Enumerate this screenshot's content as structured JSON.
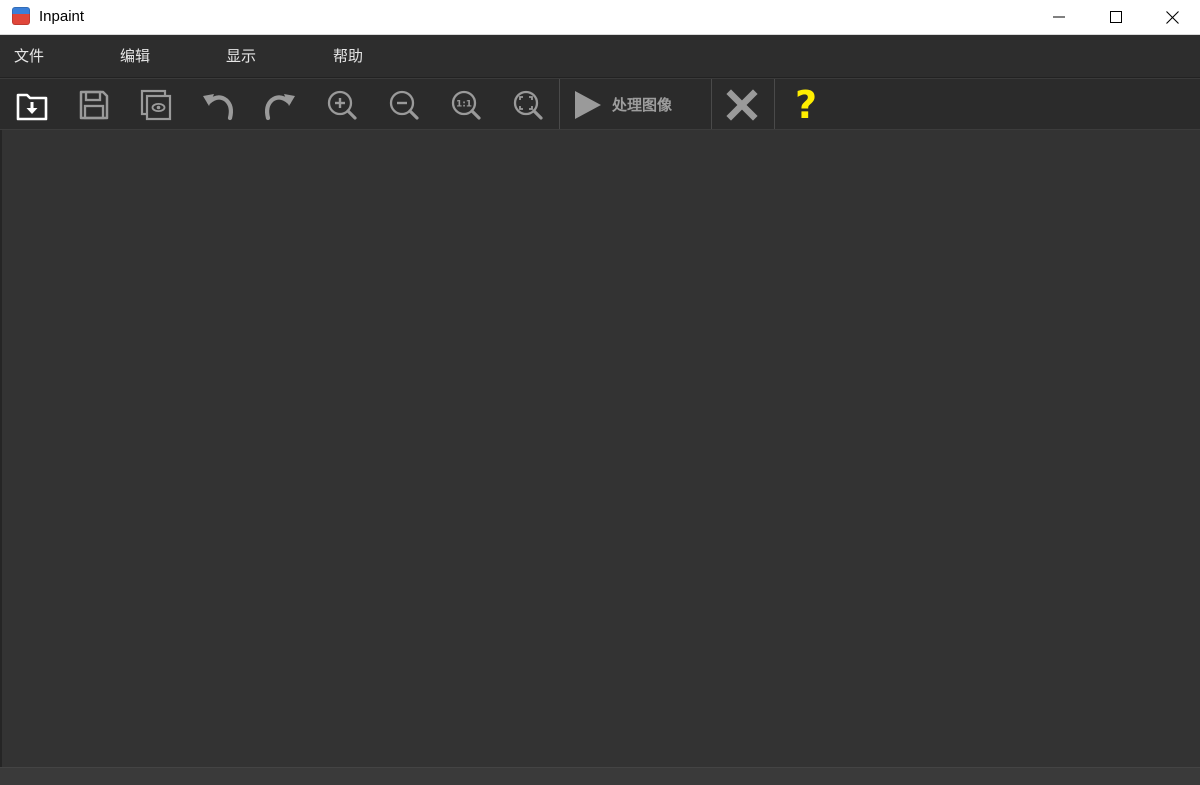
{
  "window": {
    "title": "Inpaint",
    "controls": {
      "minimize_icon": "minimize-icon",
      "maximize_icon": "maximize-icon",
      "close_icon": "close-icon"
    }
  },
  "menu": {
    "items": [
      {
        "label": "文件"
      },
      {
        "label": "编辑"
      },
      {
        "label": "显示"
      },
      {
        "label": "帮助"
      }
    ]
  },
  "toolbar": {
    "tools": [
      {
        "icon": "open-file-icon"
      },
      {
        "icon": "save-icon"
      },
      {
        "icon": "preview-icon"
      },
      {
        "icon": "undo-icon"
      },
      {
        "icon": "redo-icon"
      },
      {
        "icon": "zoom-in-icon"
      },
      {
        "icon": "zoom-out-icon"
      },
      {
        "icon": "zoom-actual-size-icon"
      },
      {
        "icon": "zoom-fit-icon"
      }
    ],
    "process": {
      "label": "处理图像",
      "icon": "play-icon"
    },
    "cancel": {
      "icon": "cancel-x-icon"
    },
    "help": {
      "icon": "help-question-icon",
      "glyph": "?"
    },
    "zoom_actual_label": "1:1"
  },
  "colors": {
    "background": "#333333",
    "toolbar": "#2b2b2b",
    "menubar": "#2d2d2d",
    "icon_white": "#ffffff",
    "icon_gray": "#9a9a9a",
    "help_yellow": "#ffee00"
  }
}
